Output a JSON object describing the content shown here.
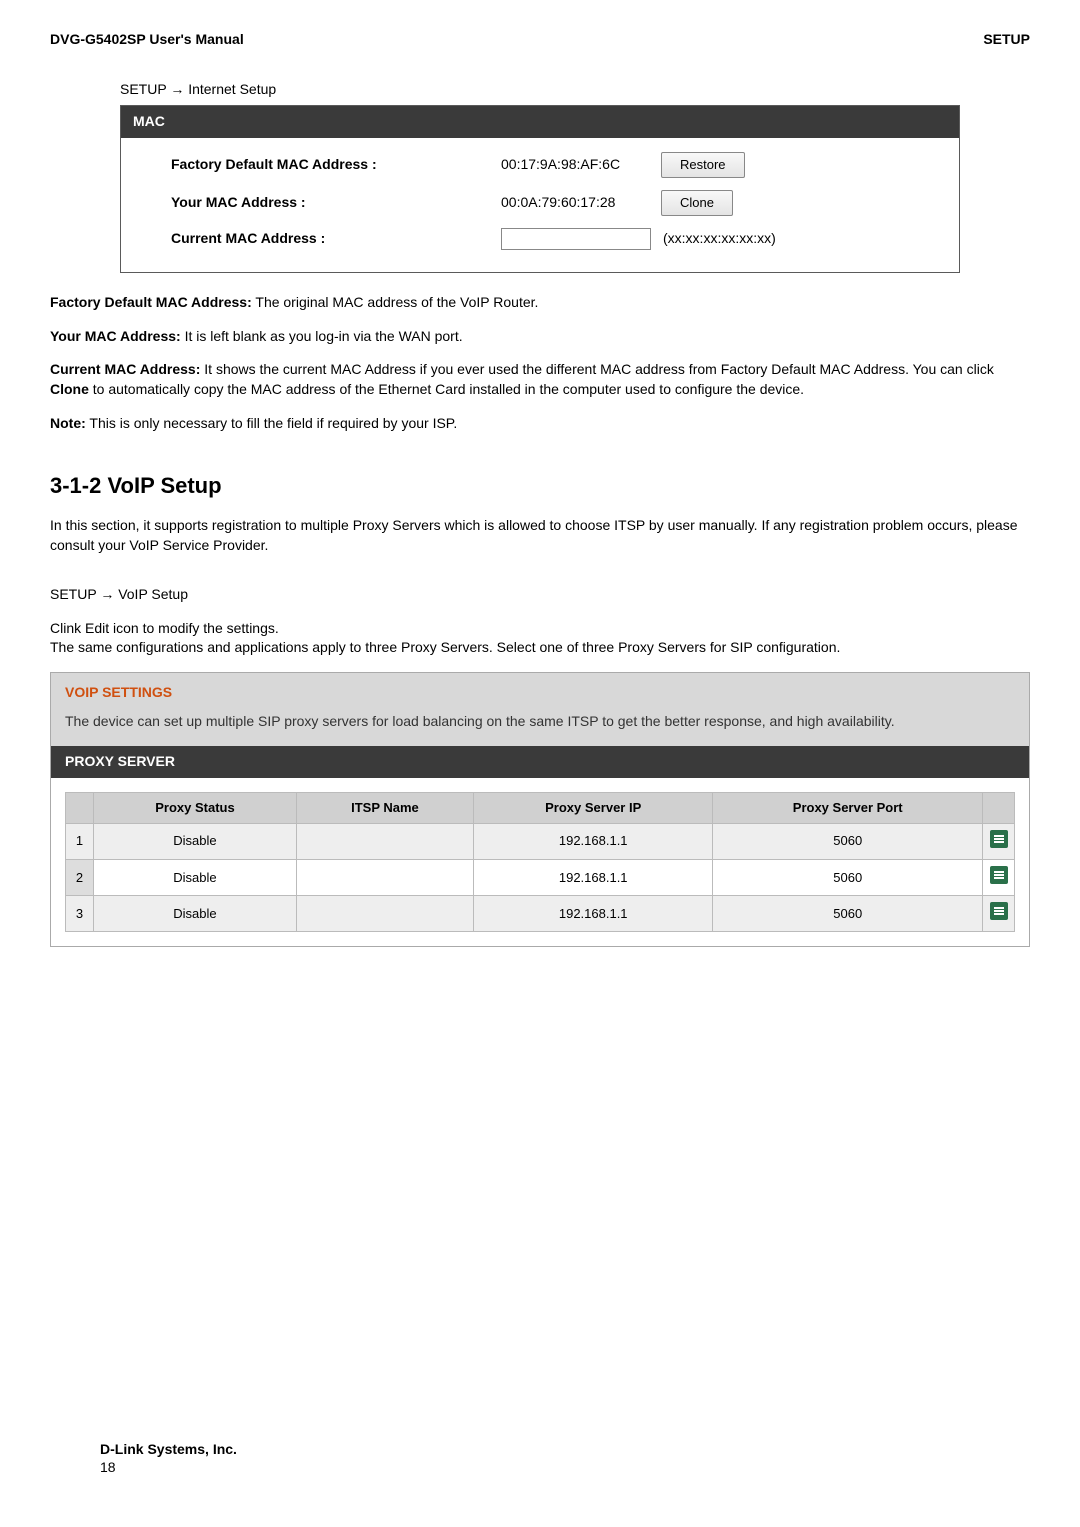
{
  "header": {
    "manual_title": "DVG-G5402SP User's Manual",
    "section_tag": "SETUP"
  },
  "breadcrumb1": "SETUP → Internet Setup",
  "mac_panel": {
    "title": "MAC",
    "rows": {
      "factory": {
        "label": "Factory Default MAC Address :",
        "value": "00:17:9A:98:AF:6C",
        "button": "Restore"
      },
      "your": {
        "label": "Your MAC Address :",
        "value": "00:0A:79:60:17:28",
        "button": "Clone"
      },
      "current": {
        "label": "Current MAC Address :",
        "hint": "(xx:xx:xx:xx:xx:xx)"
      }
    }
  },
  "paragraphs": {
    "p1_strong": "Factory Default MAC Address:",
    "p1_rest": " The original MAC address of the VoIP Router.",
    "p2_strong": "Your MAC Address:",
    "p2_rest": " It is left blank as you log-in via the WAN port.",
    "p3_strong": "Current MAC Address:",
    "p3_rest": " It shows the current MAC Address if you ever used the different MAC address from Factory Default MAC Address. You can click ",
    "p3_bold": "Clone",
    "p3_tail": " to automatically copy the MAC address of the Ethernet Card installed in the computer used to configure the device.",
    "p4_strong": "Note:",
    "p4_rest": " This is only necessary to fill the field if required by your ISP."
  },
  "section_heading": "3-1-2 VoIP Setup",
  "section_desc": "In this section, it supports registration to multiple Proxy Servers which is allowed to choose ITSP by user manually. If any registration problem occurs, please consult your VoIP Service Provider.",
  "breadcrumb2": "SETUP → VoIP Setup",
  "edit_hint1": "Clink Edit icon to modify the settings.",
  "edit_hint2": "The same configurations and applications apply to three Proxy Servers. Select one of three Proxy Servers for SIP configuration.",
  "voip_panel": {
    "title": "VOIP SETTINGS",
    "desc": "The device can set up multiple SIP proxy servers for load balancing on the same ITSP to get the better response, and high availability.",
    "proxy_title": "PROXY SERVER",
    "columns": [
      "",
      "Proxy Status",
      "ITSP Name",
      "Proxy Server IP",
      "Proxy Server Port",
      ""
    ],
    "rows": [
      {
        "idx": "1",
        "status": "Disable",
        "itsp": "",
        "ip": "192.168.1.1",
        "port": "5060"
      },
      {
        "idx": "2",
        "status": "Disable",
        "itsp": "",
        "ip": "192.168.1.1",
        "port": "5060"
      },
      {
        "idx": "3",
        "status": "Disable",
        "itsp": "",
        "ip": "192.168.1.1",
        "port": "5060"
      }
    ]
  },
  "footer": {
    "company": "D-Link Systems, Inc.",
    "page": "18"
  }
}
